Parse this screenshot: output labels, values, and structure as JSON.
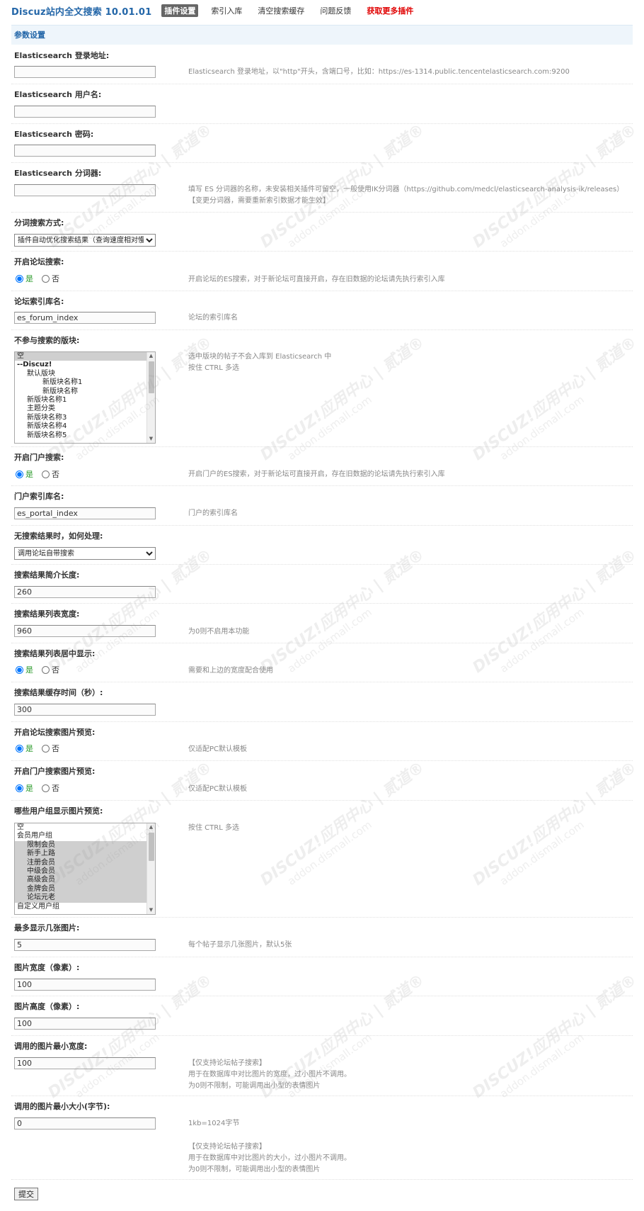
{
  "app_title": "Discuz站内全文搜索 10.01.01",
  "nav": [
    {
      "label": "插件设置",
      "active": true
    },
    {
      "label": "索引入库",
      "active": false
    },
    {
      "label": "清空搜索缓存",
      "active": false
    },
    {
      "label": "问题反馈",
      "active": false
    },
    {
      "label": "获取更多插件",
      "active": false
    }
  ],
  "section_title": "参数设置",
  "fields": {
    "es_url": {
      "label": "Elasticsearch 登录地址:",
      "value": "",
      "comment": "Elasticsearch 登录地址，以\"http\"开头，含端口号，比如：https://es-1314.public.tencentelasticsearch.com:9200"
    },
    "es_user": {
      "label": "Elasticsearch 用户名:",
      "value": ""
    },
    "es_pass": {
      "label": "Elasticsearch 密码:",
      "value": ""
    },
    "es_analyzer": {
      "label": "Elasticsearch 分词器:",
      "value": "",
      "comment_line1": "填写 ES 分词器的名称，未安装相关插件可留空，一般使用IK分词器（https://github.com/medcl/elasticsearch-analysis-ik/releases）",
      "comment_line2": "【变更分词器，需要重新索引数据才能生效】"
    },
    "seg_mode": {
      "label": "分词搜索方式:",
      "selected": "插件自动优化搜索结果（查询速度相对慢）"
    },
    "forum_search": {
      "label": "开启论坛搜索:",
      "yes": "是",
      "no": "否",
      "comment": "开启论坛的ES搜索，对于新论坛可直接开启，存在旧数据的论坛请先执行索引入库"
    },
    "forum_index": {
      "label": "论坛索引库名:",
      "value": "es_forum_index",
      "comment": "论坛的索引库名"
    },
    "exclude_forums": {
      "label": "不参与搜索的版块:",
      "comment_line1": "选中版块的帖子不会入库到 Elasticsearch 中",
      "comment_line2": "按住 CTRL 多选",
      "options": [
        {
          "text": "空",
          "indent": 0,
          "sel": true,
          "bold": false
        },
        {
          "text": "--Discuz!",
          "indent": 0,
          "sel": false,
          "bold": true
        },
        {
          "text": "默认版块",
          "indent": 14,
          "sel": false,
          "bold": false
        },
        {
          "text": "新版块名称1",
          "indent": 36,
          "sel": false,
          "bold": false
        },
        {
          "text": "新版块名称",
          "indent": 36,
          "sel": false,
          "bold": false
        },
        {
          "text": "新版块名称1",
          "indent": 14,
          "sel": false,
          "bold": false
        },
        {
          "text": "主题分类",
          "indent": 14,
          "sel": false,
          "bold": false
        },
        {
          "text": "新版块名称3",
          "indent": 14,
          "sel": false,
          "bold": false
        },
        {
          "text": "新版块名称4",
          "indent": 14,
          "sel": false,
          "bold": false
        },
        {
          "text": "新版块名称5",
          "indent": 14,
          "sel": false,
          "bold": false
        }
      ]
    },
    "portal_search": {
      "label": "开启门户搜索:",
      "yes": "是",
      "no": "否",
      "comment": "开启门户的ES搜索，对于新论坛可直接开启，存在旧数据的论坛请先执行索引入库"
    },
    "portal_index": {
      "label": "门户索引库名:",
      "value": "es_portal_index",
      "comment": "门户的索引库名"
    },
    "no_result": {
      "label": "无搜索结果时，如何处理:",
      "selected": "调用论坛自带搜索"
    },
    "summary_len": {
      "label": "搜索结果简介长度:",
      "value": "260"
    },
    "list_width": {
      "label": "搜索结果列表宽度:",
      "value": "960",
      "comment": "为0则不启用本功能"
    },
    "list_center": {
      "label": "搜索结果列表居中显示:",
      "yes": "是",
      "no": "否",
      "comment": "需要和上边的宽度配合使用"
    },
    "cache_time": {
      "label": "搜索结果缓存时间（秒）:",
      "value": "300"
    },
    "forum_img": {
      "label": "开启论坛搜索图片预览:",
      "yes": "是",
      "no": "否",
      "comment": "仅适配PC默认模板"
    },
    "portal_img": {
      "label": "开启门户搜索图片预览:",
      "yes": "是",
      "no": "否",
      "comment": "仅适配PC默认模板"
    },
    "img_groups": {
      "label": "哪些用户组显示图片预览:",
      "comment": "按住 CTRL 多选",
      "options": [
        {
          "text": "空",
          "indent": 0,
          "sel": false,
          "bold": false
        },
        {
          "text": "会员用户组",
          "indent": 0,
          "sel": false,
          "bold": false
        },
        {
          "text": "限制会员",
          "indent": 14,
          "sel": true,
          "bold": false
        },
        {
          "text": "新手上路",
          "indent": 14,
          "sel": true,
          "bold": false
        },
        {
          "text": "注册会员",
          "indent": 14,
          "sel": true,
          "bold": false
        },
        {
          "text": "中级会员",
          "indent": 14,
          "sel": true,
          "bold": false
        },
        {
          "text": "高级会员",
          "indent": 14,
          "sel": true,
          "bold": false
        },
        {
          "text": "金牌会员",
          "indent": 14,
          "sel": true,
          "bold": false
        },
        {
          "text": "论坛元老",
          "indent": 14,
          "sel": true,
          "bold": false
        },
        {
          "text": "自定义用户组",
          "indent": 0,
          "sel": false,
          "bold": false
        }
      ]
    },
    "max_imgs": {
      "label": "最多显示几张图片:",
      "value": "5",
      "comment": "每个帖子显示几张图片，默认5张"
    },
    "img_width": {
      "label": "图片宽度（像素）:",
      "value": "100"
    },
    "img_height": {
      "label": "图片高度（像素）:",
      "value": "100"
    },
    "min_width": {
      "label": "调用的图片最小宽度:",
      "value": "100",
      "comment_line1": "【仅支持论坛帖子搜索】",
      "comment_line2": "用于在数据库中对比图片的宽度，过小图片不调用。",
      "comment_line3": "为0则不限制，可能调用出小型的表情图片"
    },
    "min_size": {
      "label": "调用的图片最小大小(字节):",
      "value": "0",
      "comment_line1": "1kb=1024字节",
      "comment_line2": "【仅支持论坛帖子搜索】",
      "comment_line3": "用于在数据库中对比图片的大小，过小图片不调用。",
      "comment_line4": "为0则不限制，可能调用出小型的表情图片"
    }
  },
  "submit_label": "提交",
  "watermark": {
    "line1": "DISCUZ!应用中心 | 贰道®",
    "line2": "addon.dismall.com"
  }
}
